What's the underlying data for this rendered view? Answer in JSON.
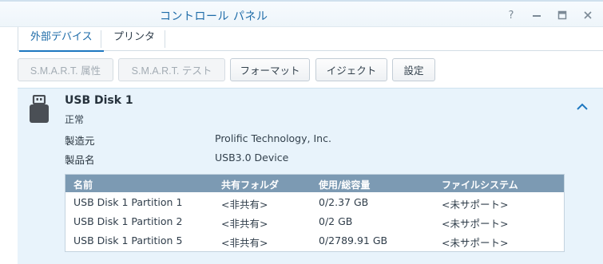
{
  "window": {
    "title": "コントロール パネル",
    "controls": [
      "?",
      "—",
      "□",
      "✕"
    ]
  },
  "tabs": [
    {
      "label": "外部デバイス",
      "active": true
    },
    {
      "label": "プリンタ",
      "active": false
    }
  ],
  "toolbar": {
    "smart_attr": "S.M.A.R.T. 属性",
    "smart_test": "S.M.A.R.T. テスト",
    "format": "フォーマット",
    "eject": "イジェクト",
    "settings": "設定"
  },
  "device": {
    "name": "USB Disk 1",
    "status": "正常",
    "manufacturer_label": "製造元",
    "manufacturer": "Prolific Technology, Inc.",
    "product_label": "製品名",
    "product": "USB3.0 Device"
  },
  "partitions": {
    "columns": [
      "名前",
      "共有フォルダ",
      "使用/総容量",
      "ファイルシステム"
    ],
    "rows": [
      [
        "USB Disk 1 Partition 1",
        "<非共有>",
        "0/2.37 GB",
        "<未サポート>"
      ],
      [
        "USB Disk 1 Partition 2",
        "<非共有>",
        "0/2 GB",
        "<未サポート>"
      ],
      [
        "USB Disk 1 Partition 5",
        "<非共有>",
        "0/2789.91 GB",
        "<未サポート>"
      ]
    ]
  },
  "colors": {
    "accent": "#1d77c0",
    "panel_bg": "#e8f3fb",
    "table_header": "#7c9ab3"
  },
  "icons": [
    "help-icon",
    "minimize-icon",
    "maximize-icon",
    "close-icon",
    "usb-drive-icon",
    "chevron-up-icon"
  ]
}
